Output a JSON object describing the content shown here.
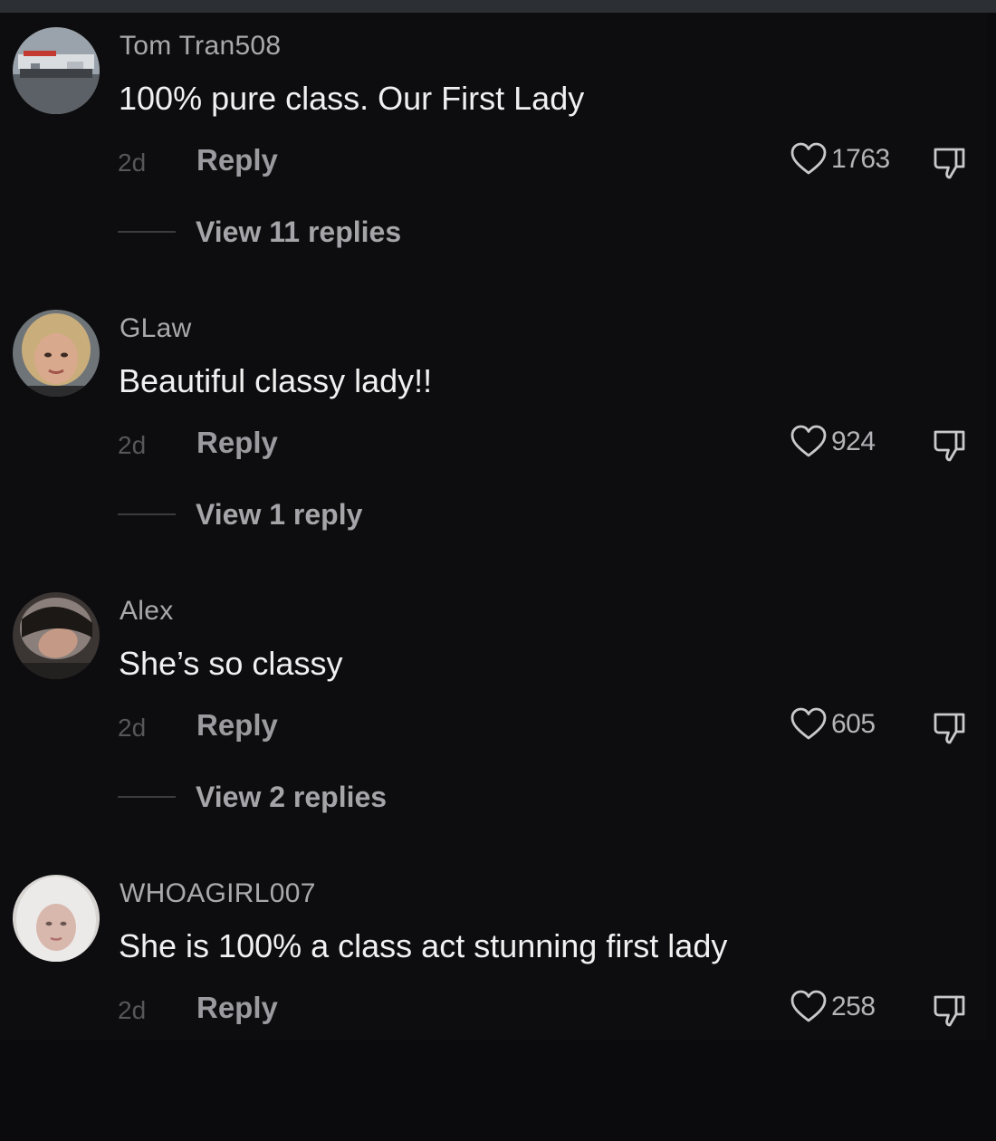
{
  "comments": [
    {
      "username": "Tom Tran508",
      "text": "100% pure class. Our First Lady",
      "age": "2d",
      "reply_label": "Reply",
      "likes": "1763",
      "view_replies": "View 11 replies"
    },
    {
      "username": "GLaw",
      "text": "Beautiful classy lady!!",
      "age": "2d",
      "reply_label": "Reply",
      "likes": "924",
      "view_replies": "View 1 reply"
    },
    {
      "username": "Alex",
      "text": "She’s so classy",
      "age": "2d",
      "reply_label": "Reply",
      "likes": "605",
      "view_replies": "View 2 replies"
    },
    {
      "username": "WHOAGIRL007",
      "text": "She is 100% a class act stunning first lady",
      "age": "2d",
      "reply_label": "Reply",
      "likes": "258"
    }
  ],
  "icons": {
    "like": "heart-icon",
    "dislike": "thumbs-down-icon"
  },
  "colors": {
    "background": "#0d0d0f",
    "username": "#a9a9ad",
    "comment_text": "#f0f0f1",
    "secondary": "#9a9a9f"
  }
}
